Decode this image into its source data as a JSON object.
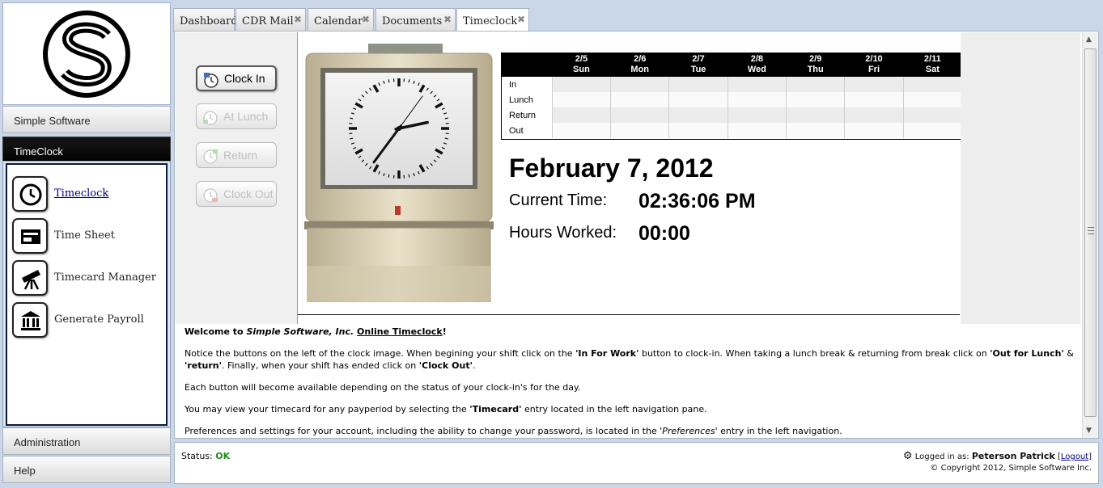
{
  "nav": {
    "sections": {
      "simple_software": "Simple Software",
      "timeclock": "TimeClock",
      "administration": "Administration",
      "help": "Help"
    },
    "items": [
      {
        "label": "Timeclock",
        "icon": "clock-icon"
      },
      {
        "label": "Time Sheet",
        "icon": "time-sheet-icon"
      },
      {
        "label": "Timecard Manager",
        "icon": "telescope-icon"
      },
      {
        "label": "Generate Payroll",
        "icon": "bank-icon"
      }
    ]
  },
  "tabs": [
    {
      "label": "Dashboard",
      "closable": false
    },
    {
      "label": "CDR Mail",
      "closable": true
    },
    {
      "label": "Calendar",
      "closable": true
    },
    {
      "label": "Documents",
      "closable": true
    },
    {
      "label": "Timeclock",
      "closable": true,
      "active": true
    }
  ],
  "tab_close_glyph": "✖",
  "timeclock": {
    "buttons": {
      "clock_in": "Clock In",
      "at_lunch": "At Lunch",
      "return": "Return",
      "clock_out": "Clock Out"
    },
    "week": {
      "days": [
        {
          "date": "2/5",
          "day": "Sun"
        },
        {
          "date": "2/6",
          "day": "Mon"
        },
        {
          "date": "2/7",
          "day": "Tue"
        },
        {
          "date": "2/8",
          "day": "Wed"
        },
        {
          "date": "2/9",
          "day": "Thu"
        },
        {
          "date": "2/10",
          "day": "Fri"
        },
        {
          "date": "2/11",
          "day": "Sat"
        }
      ],
      "rows": [
        "In",
        "Lunch",
        "Return",
        "Out"
      ]
    },
    "date": "February 7, 2012",
    "current_time_label": "Current Time:",
    "current_time": "02:36:06 PM",
    "hours_worked_label": "Hours Worked:",
    "hours_worked": "00:00",
    "clock_face": {
      "hour": 2,
      "minute": 36,
      "second": 6
    }
  },
  "welcome": {
    "p1_a": "Welcome to ",
    "p1_b": "Simple Software, Inc.",
    "p1_link": "Online Timeclock",
    "p1_end": "!",
    "p2_a": "Notice the buttons on the left of the clock image. When begining your shift click on the ",
    "p2_b": "'In For Work'",
    "p2_c": " button to clock-in. When taking a lunch break & returning from break click on ",
    "p2_d": "'Out for Lunch'",
    "p2_e": " & ",
    "p2_f": "'return'",
    "p2_g": ". Finally, when your shift has ended click on ",
    "p2_h": "'Clock Out'",
    "p2_i": ".",
    "p3": "Each button will become available depending on the status of your clock-in's for the day.",
    "p4_a": "You may view your timecard for any payperiod by selecting the ",
    "p4_b": "'Timecard'",
    "p4_c": " entry located in the left navigation pane.",
    "p5_a": "Preferences and settings for your account, including the ability to change your password, is located in the ",
    "p5_b": "'Preferences'",
    "p5_c": " entry in the left navigation."
  },
  "status": {
    "label": "Status:",
    "value": "OK",
    "logged_in_label": "Logged in as:",
    "user": "Peterson Patrick",
    "logout": "Logout",
    "copyright": "© Copyright 2012, Simple Software Inc."
  }
}
